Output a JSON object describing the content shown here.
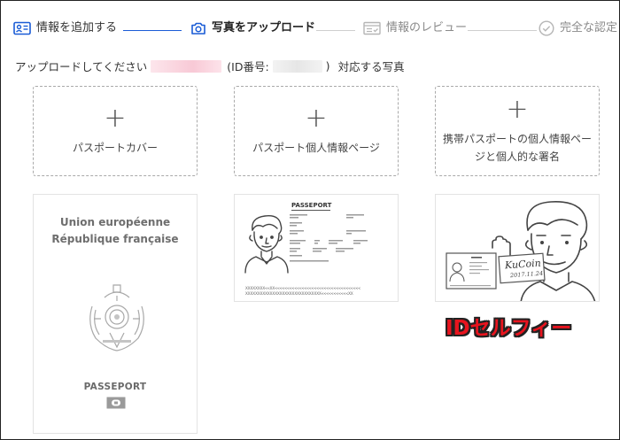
{
  "stepper": {
    "steps": [
      {
        "label": "情報を追加する",
        "state": "done",
        "icon": "id-card-icon"
      },
      {
        "label": "写真をアップロード",
        "state": "active",
        "icon": "camera-icon"
      },
      {
        "label": "情報のレビュー",
        "state": "todo",
        "icon": "review-form-icon"
      },
      {
        "label": "完全な認定",
        "state": "todo",
        "icon": "check-circle-icon"
      }
    ],
    "colors": {
      "active": "#1a5cd6",
      "inactive": "#bfbfbf"
    }
  },
  "instruction": {
    "prefix": "アップロードしてください",
    "id_open": "(ID番号:",
    "id_close": ")",
    "suffix": "対応する写真"
  },
  "uploads": [
    {
      "plus": "+",
      "label": "パスポートカバー"
    },
    {
      "plus": "+",
      "label": "パスポート個人情報ページ"
    },
    {
      "plus": "+",
      "label": "携帯パスポートの個人情報ページと個人的な署名"
    }
  ],
  "samples": {
    "cover": {
      "line1": "Union européenne",
      "line2": "République française",
      "passport_word": "PASSEPORT"
    },
    "datapage": {
      "heading": "PASSEPORT",
      "mrz1": "XXXXXXXX<<XX<<<<<<<<<<<<<<<<<<<<<<<<<<<<<<<<<<<",
      "mrz2": "XXXXXXXXXXXXXXXXXXXXXXXXXXXXXXX<<<<<<<<<<<XX"
    },
    "selfie": {
      "note_brand": "KuCoin",
      "note_date": "2017.11.24",
      "caption": "IDセルフィー",
      "caption_color": "#e8141e"
    }
  }
}
